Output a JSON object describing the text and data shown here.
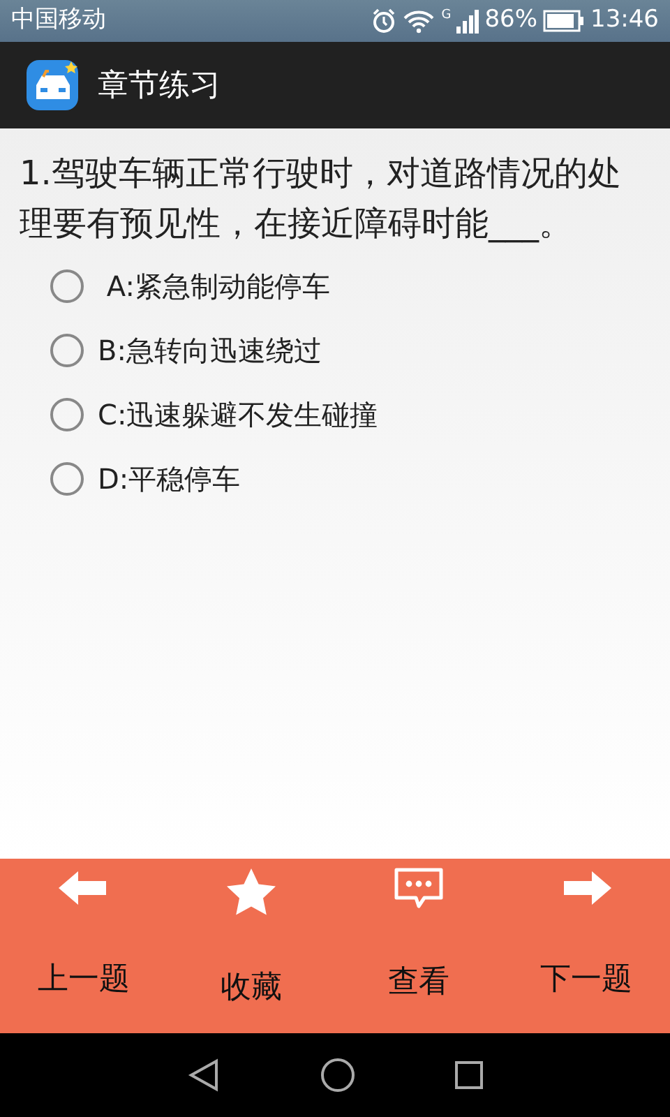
{
  "status_bar": {
    "carrier": "中国移动",
    "network": "G",
    "battery": "86%",
    "time": "13:46"
  },
  "action_bar": {
    "title": "章节练习"
  },
  "question": {
    "text": "1.驾驶车辆正常行驶时，对道路情况的处理要有预见性，在接近障碍时能___。",
    "options": [
      {
        "label": " A:紧急制动能停车",
        "selected": false
      },
      {
        "label": "B:急转向迅速绕过",
        "selected": false
      },
      {
        "label": "C:迅速躲避不发生碰撞",
        "selected": false
      },
      {
        "label": "D:平稳停车",
        "selected": false
      }
    ]
  },
  "toolbar": [
    {
      "kind": "prev",
      "label": "上一题"
    },
    {
      "kind": "favorite",
      "label": "收藏"
    },
    {
      "kind": "view",
      "label": "查看"
    },
    {
      "kind": "next",
      "label": "下一题"
    }
  ]
}
